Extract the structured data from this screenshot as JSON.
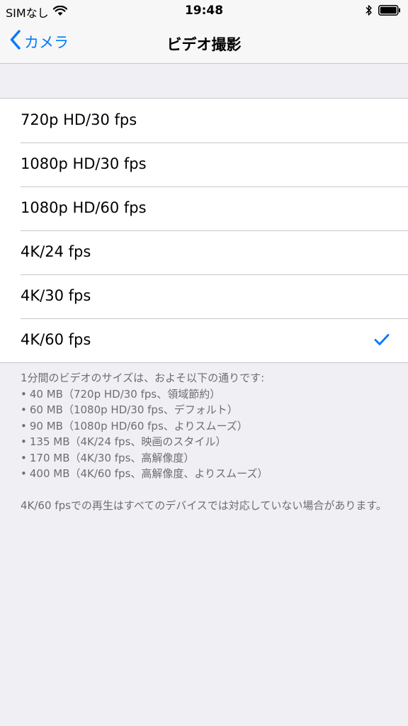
{
  "status_bar": {
    "carrier": "SIMなし",
    "time": "19:48"
  },
  "nav": {
    "back_label": "カメラ",
    "title": "ビデオ撮影"
  },
  "options": [
    {
      "label": "720p HD/30 fps",
      "selected": false
    },
    {
      "label": "1080p HD/30 fps",
      "selected": false
    },
    {
      "label": "1080p HD/60 fps",
      "selected": false
    },
    {
      "label": "4K/24 fps",
      "selected": false
    },
    {
      "label": "4K/30 fps",
      "selected": false
    },
    {
      "label": "4K/60 fps",
      "selected": true
    }
  ],
  "footer": {
    "intro": "1分間のビデオのサイズは、およそ以下の通りです:",
    "sizes": [
      "40 MB（720p HD/30 fps、領域節約）",
      "60 MB（1080p HD/30 fps、デフォルト）",
      "90 MB（1080p HD/60 fps、よりスムーズ）",
      "135 MB（4K/24 fps、映画のスタイル）",
      "170 MB（4K/30 fps、高解像度）",
      "400 MB（4K/60 fps、高解像度、よりスムーズ）"
    ],
    "note": "4K/60 fpsでの再生はすべてのデバイスでは対応していない場合があります。"
  },
  "colors": {
    "accent": "#007aff",
    "background": "#efeff4",
    "footer_text": "#6d6d72"
  }
}
